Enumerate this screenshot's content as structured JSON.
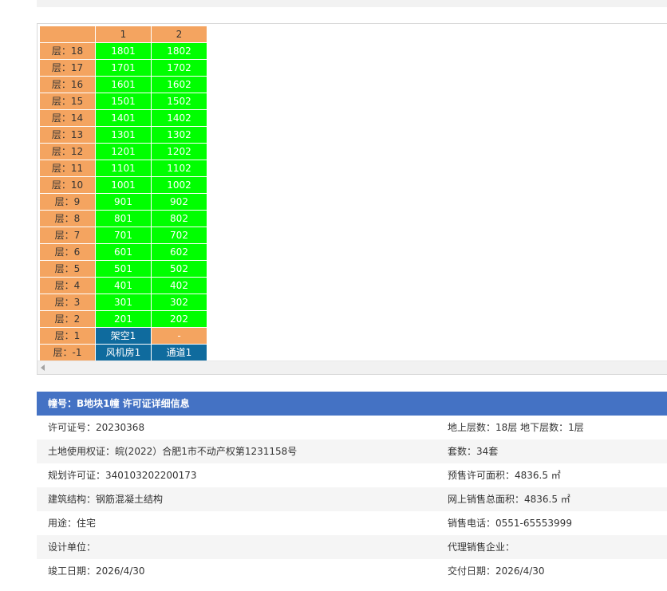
{
  "header_cols": [
    "",
    "1",
    "2"
  ],
  "floors": [
    {
      "label": "层：18",
      "units": [
        "1801",
        "1802"
      ]
    },
    {
      "label": "层：17",
      "units": [
        "1701",
        "1702"
      ]
    },
    {
      "label": "层：16",
      "units": [
        "1601",
        "1602"
      ]
    },
    {
      "label": "层：15",
      "units": [
        "1501",
        "1502"
      ]
    },
    {
      "label": "层：14",
      "units": [
        "1401",
        "1402"
      ]
    },
    {
      "label": "层：13",
      "units": [
        "1301",
        "1302"
      ]
    },
    {
      "label": "层：12",
      "units": [
        "1201",
        "1202"
      ]
    },
    {
      "label": "层：11",
      "units": [
        "1101",
        "1102"
      ]
    },
    {
      "label": "层：10",
      "units": [
        "1001",
        "1002"
      ]
    },
    {
      "label": "层：9",
      "units": [
        "901",
        "902"
      ]
    },
    {
      "label": "层：8",
      "units": [
        "801",
        "802"
      ]
    },
    {
      "label": "层：7",
      "units": [
        "701",
        "702"
      ]
    },
    {
      "label": "层：6",
      "units": [
        "601",
        "602"
      ]
    },
    {
      "label": "层：5",
      "units": [
        "501",
        "502"
      ]
    },
    {
      "label": "层：4",
      "units": [
        "401",
        "402"
      ]
    },
    {
      "label": "层：3",
      "units": [
        "301",
        "302"
      ]
    },
    {
      "label": "层：2",
      "units": [
        "201",
        "202"
      ]
    }
  ],
  "special_floors": [
    {
      "label": "层：1",
      "units": [
        "架空1",
        "-"
      ]
    },
    {
      "label": "层：-1",
      "units": [
        "风机房1",
        "通道1"
      ]
    }
  ],
  "colors": {
    "floor_header": "#f4a460",
    "available_unit": "#00ff00",
    "special_unit": "#0f6b9e",
    "info_header": "#4472c4"
  },
  "info": {
    "title": "幢号：B地块1幢 许可证详细信息",
    "rows": [
      {
        "left": "许可证号：20230368",
        "right": "地上层数：18层  地下层数：1层"
      },
      {
        "left": "土地使用权证：皖(2022）合肥1市不动产权第1231158号",
        "right": "套数：34套"
      },
      {
        "left": "规划许可证：340103202200173",
        "right": "预售许可面积：4836.5 ㎡"
      },
      {
        "left": "建筑结构：钢筋混凝土结构",
        "right": "网上销售总面积：4836.5 ㎡"
      },
      {
        "left": "用途：住宅",
        "right": "销售电话：0551-65553999"
      },
      {
        "left": "设计单位：",
        "right": "代理销售企业："
      },
      {
        "left": "竣工日期：2026/4/30",
        "right": "交付日期：2026/4/30"
      }
    ]
  }
}
